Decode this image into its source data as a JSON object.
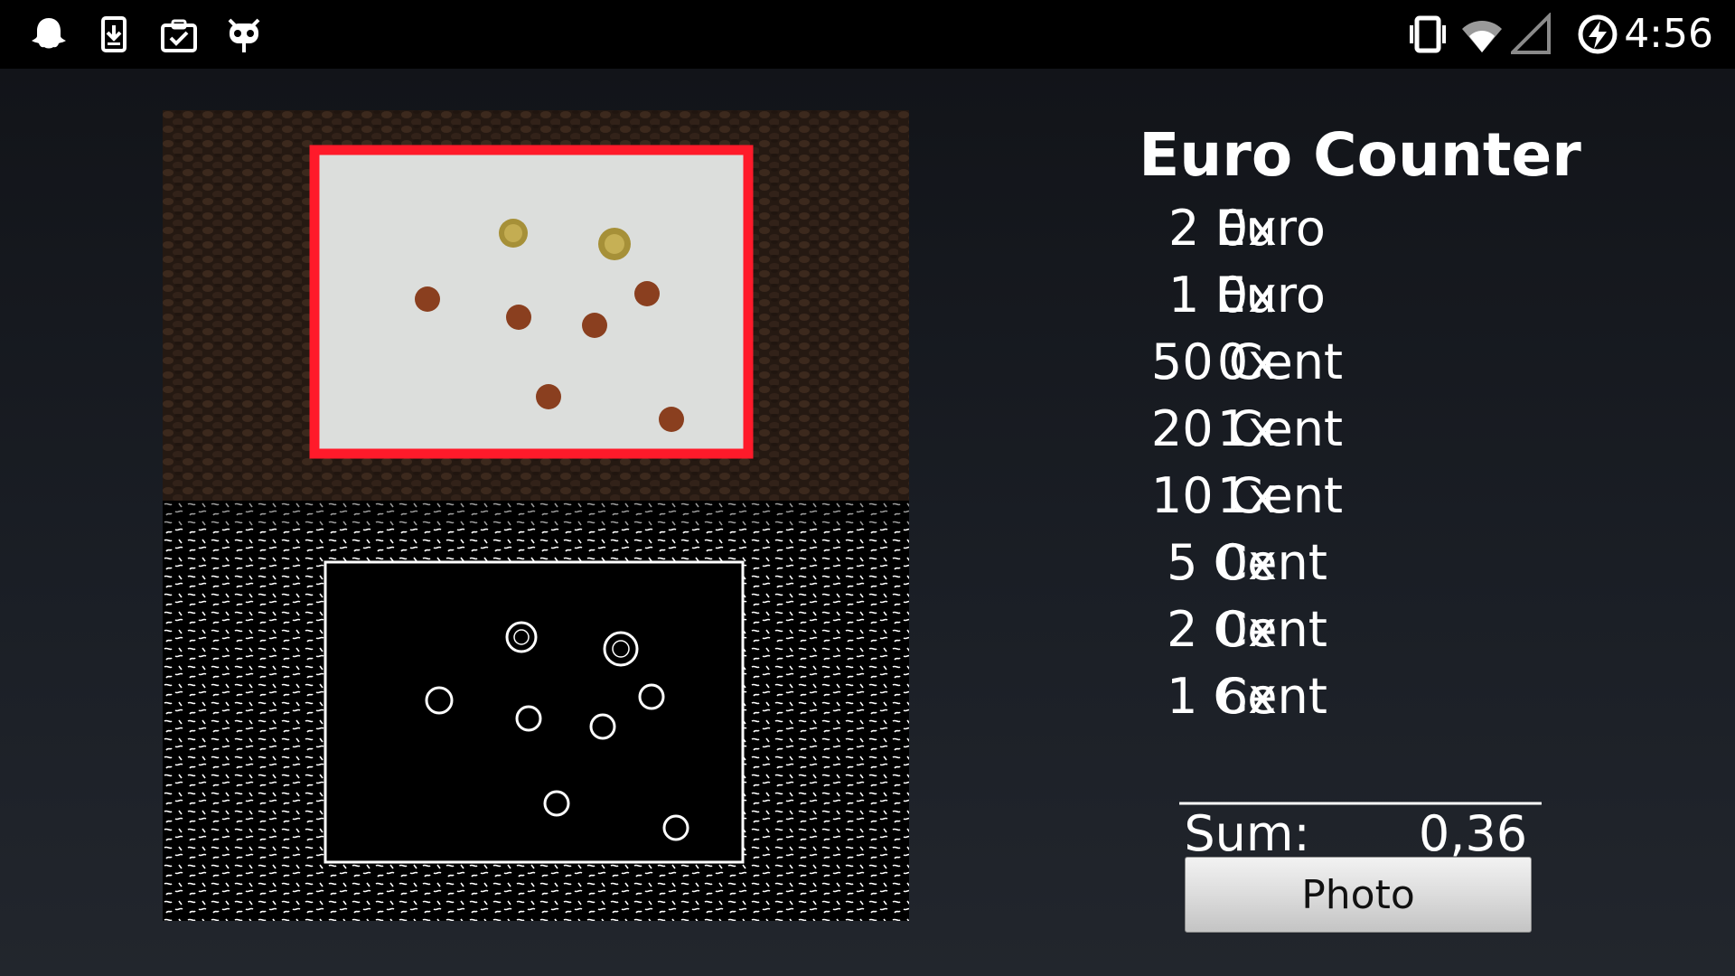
{
  "status_bar": {
    "time": "4:56",
    "left_icons": [
      "ghost-notification-icon",
      "download-icon",
      "clipboard-check-icon",
      "android-bot-icon"
    ],
    "right_icons": [
      "vibrate-icon",
      "wifi-icon",
      "cell-signal-icon",
      "battery-charging-icon"
    ]
  },
  "app": {
    "title": "Euro Counter",
    "coins": [
      {
        "name": "2 Euro",
        "count": "0x"
      },
      {
        "name": "1 Euro",
        "count": "0x"
      },
      {
        "name": "50 Cent",
        "count": "0x"
      },
      {
        "name": "20 Cent",
        "count": "1x"
      },
      {
        "name": "10 Cent",
        "count": "1x"
      },
      {
        "name": "5 Cent",
        "count": "0x"
      },
      {
        "name": "2 Cent",
        "count": "0x"
      },
      {
        "name": "1 Cent",
        "count": "6x"
      }
    ],
    "separator": "___________________",
    "sum_label": "Sum:",
    "sum_value": "0,36",
    "photo_button": "Photo"
  },
  "colors": {
    "detection_frame": "#ff1a2a",
    "status_bar_bg": "#000000",
    "button_text": "#111111"
  }
}
